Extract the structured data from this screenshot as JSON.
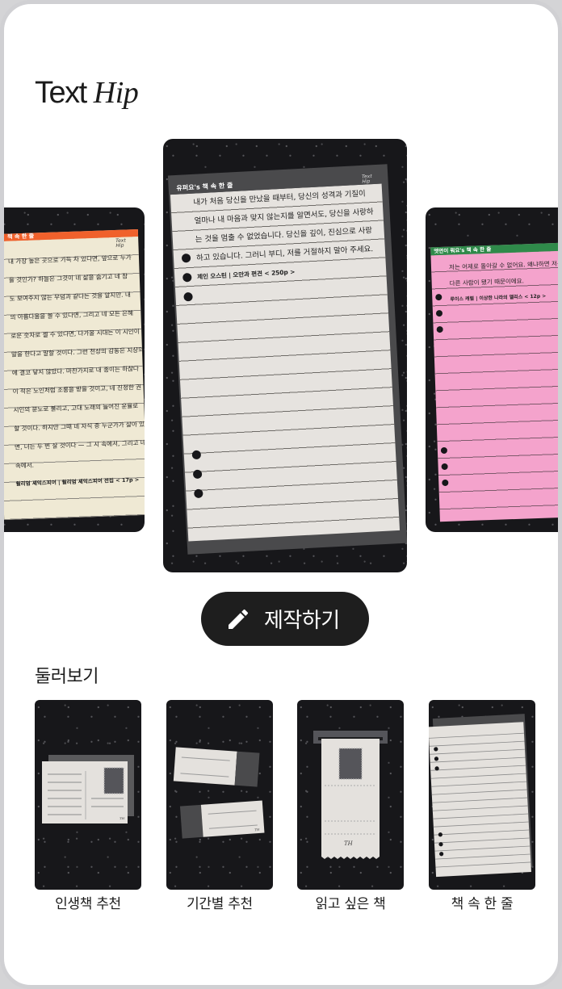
{
  "app": {
    "logo_text": "Text",
    "logo_accent": "Hip"
  },
  "carousel": {
    "center": {
      "tag": "유퍼요's 책 속 한 줄",
      "brand": "Text Hip",
      "lines": [
        "내가 처음 당신을 만났을 때부터, 당신의 성격과 기질이",
        "얼마나 내 마음과 맞지 않는지를 알면서도, 당신을 사랑하",
        "는 것을 멈출 수 없었습니다. 당신을 깊이, 진심으로 사랑",
        "하고 있습니다. 그러니 부디, 저를 거절하지 말아 주세요."
      ],
      "source": "제인 오스틴 | 오만과 편견 < 250p >"
    },
    "left": {
      "tag": "책 속 한 줄",
      "brand": "Text Hip",
      "lines": [
        "내 가장 높은 곳으로 가득 차 있다면, 앞으로 누가",
        "을 것인가? 하늘은 그것이 네 삶을 숨기고 네 참",
        "도 보여주지 않는 무덤과 같다는 것을 알지만. 내",
        "의 아름다움을 쓸 수 있다면, 그리고 네 모든 은혜",
        "로운 숫자로 셀 수 있다면, 다가올 시대는 이 시인이",
        "말을 한다고 말할 것이다. 그런 천상의 감동은 지상의",
        "에 결코 닿지 않았다. 마찬가지로 내 종이는 하찮다",
        "이 적은 노인처럼 조롱을 받을 것이고, 네 진정한 권",
        "시인의 분노로 불리고, 고대 노래의 늘어진 운율로",
        "할 것이다. 하지만 그때 네 자식 중 누군가가 살아 있었",
        "면, 너는 두 번 살 것이다 — 그 시 속에서, 그리고 네 운",
        "속에서."
      ],
      "source": "윌리엄 셰익스피어 | 윌리엄 셰익스피어 전집 < 17p >"
    },
    "right": {
      "tag": "엣연이 뭐요's 책 속 한 줄",
      "lines": [
        "저는 어제로 돌아갈 수 없어요. 왜냐하면 저는",
        "다른 사람이 됐기 때문이에요."
      ],
      "source": "루이스 캐럴 | 이상한 나라의 앨리스 < 12p >"
    }
  },
  "make_button": {
    "label": "제작하기",
    "icon": "pencil-icon"
  },
  "browse": {
    "title": "둘러보기",
    "items": [
      {
        "label": "인생책 추천",
        "icon": "postcard-icon"
      },
      {
        "label": "기간별 추천",
        "icon": "tickets-icon"
      },
      {
        "label": "읽고 싶은 책",
        "icon": "receipt-icon"
      },
      {
        "label": "책 속 한 줄",
        "icon": "notebook-paper-icon"
      }
    ]
  },
  "colors": {
    "card_bg": "#17171a",
    "paper_cream": "#efe9d4",
    "paper_white": "#e6e3df",
    "paper_pink": "#f4a3cc",
    "tag_orange": "#f0612c",
    "tag_green": "#2f8a4a",
    "tag_gray": "#4a4a4c",
    "button_dark": "#1e1e1e"
  }
}
